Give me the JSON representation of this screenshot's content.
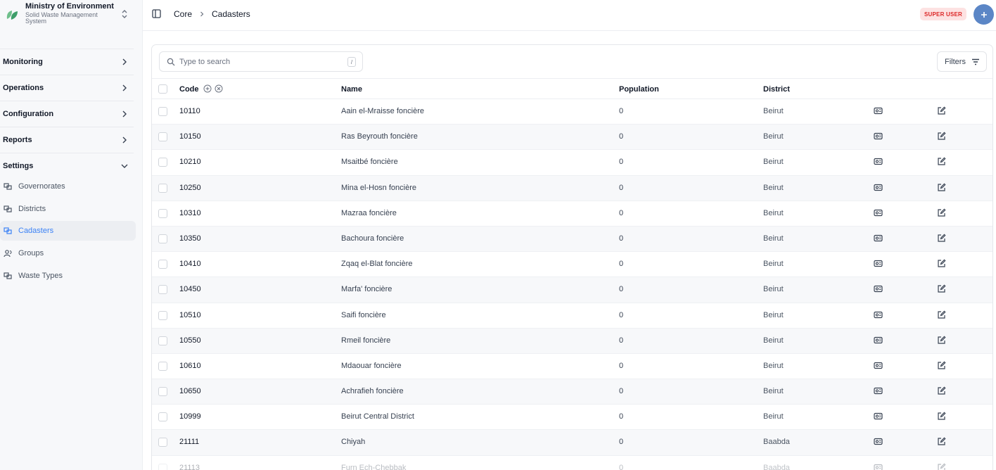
{
  "brand": {
    "title": "Ministry of Environment",
    "subtitle": "Solid Waste Management System",
    "logo_icon": "leaf-logo-icon"
  },
  "sidebar": {
    "sections": [
      {
        "label": "Monitoring",
        "expanded": false
      },
      {
        "label": "Operations",
        "expanded": false
      },
      {
        "label": "Configuration",
        "expanded": false
      },
      {
        "label": "Reports",
        "expanded": false
      },
      {
        "label": "Settings",
        "expanded": true
      }
    ],
    "settings_items": [
      {
        "label": "Governorates",
        "icon": "map-icon",
        "active": false
      },
      {
        "label": "Districts",
        "icon": "map-icon",
        "active": false
      },
      {
        "label": "Cadasters",
        "icon": "map-icon",
        "active": true
      },
      {
        "label": "Groups",
        "icon": "users-icon",
        "active": false
      },
      {
        "label": "Waste Types",
        "icon": "map-icon",
        "active": false
      }
    ]
  },
  "header": {
    "breadcrumb": [
      "Core",
      "Cadasters"
    ],
    "role_badge": "SUPER USER",
    "accent_color": "#5b86c6",
    "badge_color": "#dc2626"
  },
  "toolbar": {
    "search_placeholder": "Type to search",
    "search_shortcut": "/",
    "filters_label": "Filters"
  },
  "table": {
    "columns": {
      "code": "Code",
      "name": "Name",
      "population": "Population",
      "district": "District"
    },
    "rows": [
      {
        "code": "10110",
        "name": "Aain el-Mraisse foncière",
        "population": "0",
        "district": "Beirut"
      },
      {
        "code": "10150",
        "name": "Ras Beyrouth foncière",
        "population": "0",
        "district": "Beirut"
      },
      {
        "code": "10210",
        "name": "Msaitbé foncière",
        "population": "0",
        "district": "Beirut"
      },
      {
        "code": "10250",
        "name": "Mina el-Hosn foncière",
        "population": "0",
        "district": "Beirut"
      },
      {
        "code": "10310",
        "name": "Mazraa foncière",
        "population": "0",
        "district": "Beirut"
      },
      {
        "code": "10350",
        "name": "Bachoura foncière",
        "population": "0",
        "district": "Beirut"
      },
      {
        "code": "10410",
        "name": "Zqaq el-Blat foncière",
        "population": "0",
        "district": "Beirut"
      },
      {
        "code": "10450",
        "name": "Marfa' foncière",
        "population": "0",
        "district": "Beirut"
      },
      {
        "code": "10510",
        "name": "Saifi foncière",
        "population": "0",
        "district": "Beirut"
      },
      {
        "code": "10550",
        "name": "Rmeil foncière",
        "population": "0",
        "district": "Beirut"
      },
      {
        "code": "10610",
        "name": "Mdaouar foncière",
        "population": "0",
        "district": "Beirut"
      },
      {
        "code": "10650",
        "name": "Achrafieh foncière",
        "population": "0",
        "district": "Beirut"
      },
      {
        "code": "10999",
        "name": "Beirut Central District",
        "population": "0",
        "district": "Beirut"
      },
      {
        "code": "21111",
        "name": "Chiyah",
        "population": "0",
        "district": "Baabda"
      },
      {
        "code": "21113",
        "name": "Furn Ech-Chebbak",
        "population": "0",
        "district": "Baabda"
      }
    ]
  }
}
